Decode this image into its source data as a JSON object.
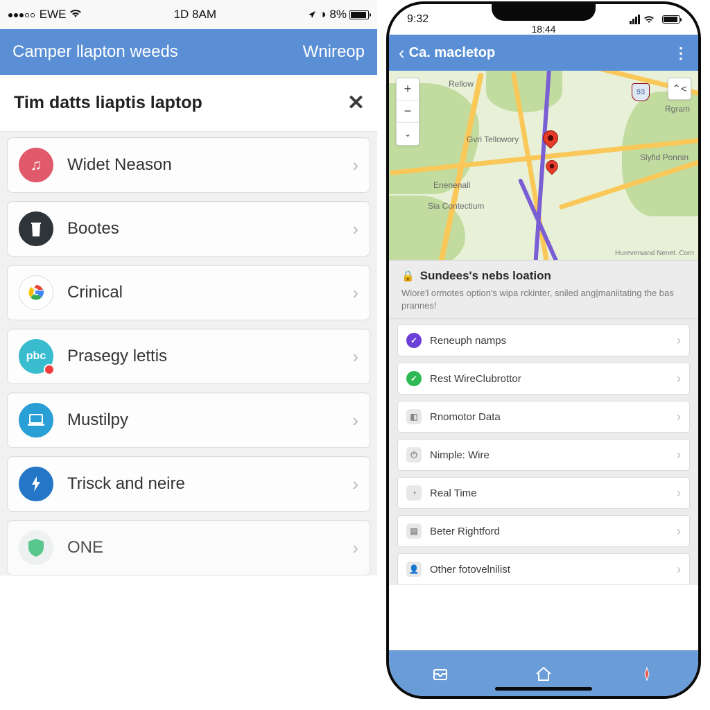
{
  "left": {
    "status": {
      "carrier": "EWE",
      "time": "1D 8AM",
      "battery": "8%"
    },
    "nav": {
      "title": "Camper llapton weeds",
      "action": "Wnireop"
    },
    "section_title": "Tim datts liaptis laptop",
    "items": [
      {
        "label": "Widet Neason"
      },
      {
        "label": "Bootes"
      },
      {
        "label": "Crinical"
      },
      {
        "label": "Prasegy lettis"
      },
      {
        "label": "Mustilpy"
      },
      {
        "label": "Trisck and neire"
      },
      {
        "label": "ONE"
      }
    ]
  },
  "right": {
    "status": {
      "left": "9:32",
      "time": "18:44"
    },
    "nav_title": "Ca. macletop",
    "map": {
      "labels": {
        "rellow": "Rellow",
        "gvri": "Gvri Tellowory",
        "ene": "Enenenall",
        "sia": "Sia Contectium",
        "slyf": "Slyfid Ponnin",
        "rgram": "Rgram"
      },
      "shield": "93",
      "attrib": "Hureversand Nenet. Corn"
    },
    "info": {
      "title": "Sundees's nebs loation",
      "sub": "Wiore'l ormotes option's wipa rckinter, sniled ang|maniitating the bas prannes!"
    },
    "items": [
      {
        "label": "Reneuph namps"
      },
      {
        "label": "Rest WireClubrottor"
      },
      {
        "label": "Rnomotor Data"
      },
      {
        "label": "Nimple: Wire"
      },
      {
        "label": "Real Time"
      },
      {
        "label": "Beter Rightford"
      },
      {
        "label": "Other fotovelnilist"
      }
    ]
  }
}
